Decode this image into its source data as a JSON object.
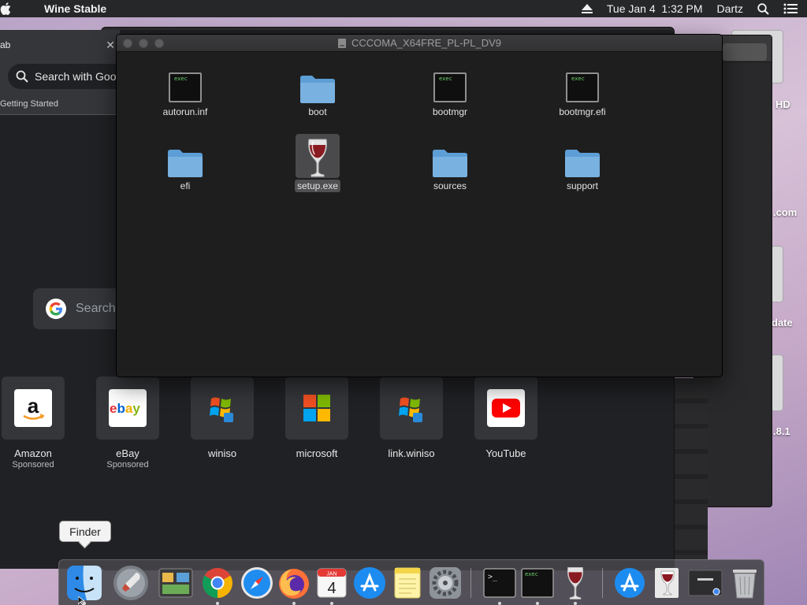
{
  "menubar": {
    "app_name": "Wine Stable",
    "datetime": "Tue Jan 4  1:32 PM",
    "user": "Dartz",
    "icons": [
      "apple-icon",
      "eject-icon",
      "spotlight-icon",
      "notification-center-icon"
    ]
  },
  "desktop": {
    "labels": [
      "HD",
      ".com",
      "date",
      ".8.1"
    ]
  },
  "browser": {
    "tab_title": "ab",
    "search_pill": "Search with Goo",
    "bookmark": "Getting Started",
    "google_search_placeholder": "Search",
    "shortcuts": [
      {
        "name": "Amazon",
        "sub": "Sponsored",
        "icon": "amazon-icon"
      },
      {
        "name": "eBay",
        "sub": "Sponsored",
        "icon": "ebay-icon"
      },
      {
        "name": "winiso",
        "sub": "",
        "icon": "windows-flag-icon"
      },
      {
        "name": "microsoft",
        "sub": "",
        "icon": "microsoft-logo-icon"
      },
      {
        "name": "link.winiso",
        "sub": "",
        "icon": "windows-flag-icon"
      },
      {
        "name": "YouTube",
        "sub": "",
        "icon": "youtube-icon"
      }
    ]
  },
  "finder": {
    "title": "CCCOMA_X64FRE_PL-PL_DV9",
    "files": [
      {
        "name": "autorun.inf",
        "kind": "exec"
      },
      {
        "name": "boot",
        "kind": "folder"
      },
      {
        "name": "bootmgr",
        "kind": "exec"
      },
      {
        "name": "bootmgr.efi",
        "kind": "exec"
      },
      {
        "name": "efi",
        "kind": "folder"
      },
      {
        "name": "setup.exe",
        "kind": "wine",
        "selected": true
      },
      {
        "name": "sources",
        "kind": "folder"
      },
      {
        "name": "support",
        "kind": "folder"
      }
    ],
    "exec_badge": "exec"
  },
  "tooltip": "Finder",
  "dock": {
    "apps": [
      "finder",
      "launchpad",
      "image-capture",
      "chrome",
      "safari",
      "firefox",
      "calendar",
      "app-store",
      "notes",
      "system-preferences",
      "terminal",
      "exec",
      "wine",
      "app-store-download",
      "wine-installer",
      "browser-window",
      "trash"
    ],
    "calendar_month": "JAN",
    "calendar_day": "4",
    "terminal_prompt": ">_",
    "exec_badge": "exec"
  },
  "colors": {
    "folder": "#79b1e0",
    "finder_bg": "#1e1e1e",
    "browser_bg": "#202124",
    "youtube": "#ff0000",
    "wine": "#8a1a22"
  }
}
